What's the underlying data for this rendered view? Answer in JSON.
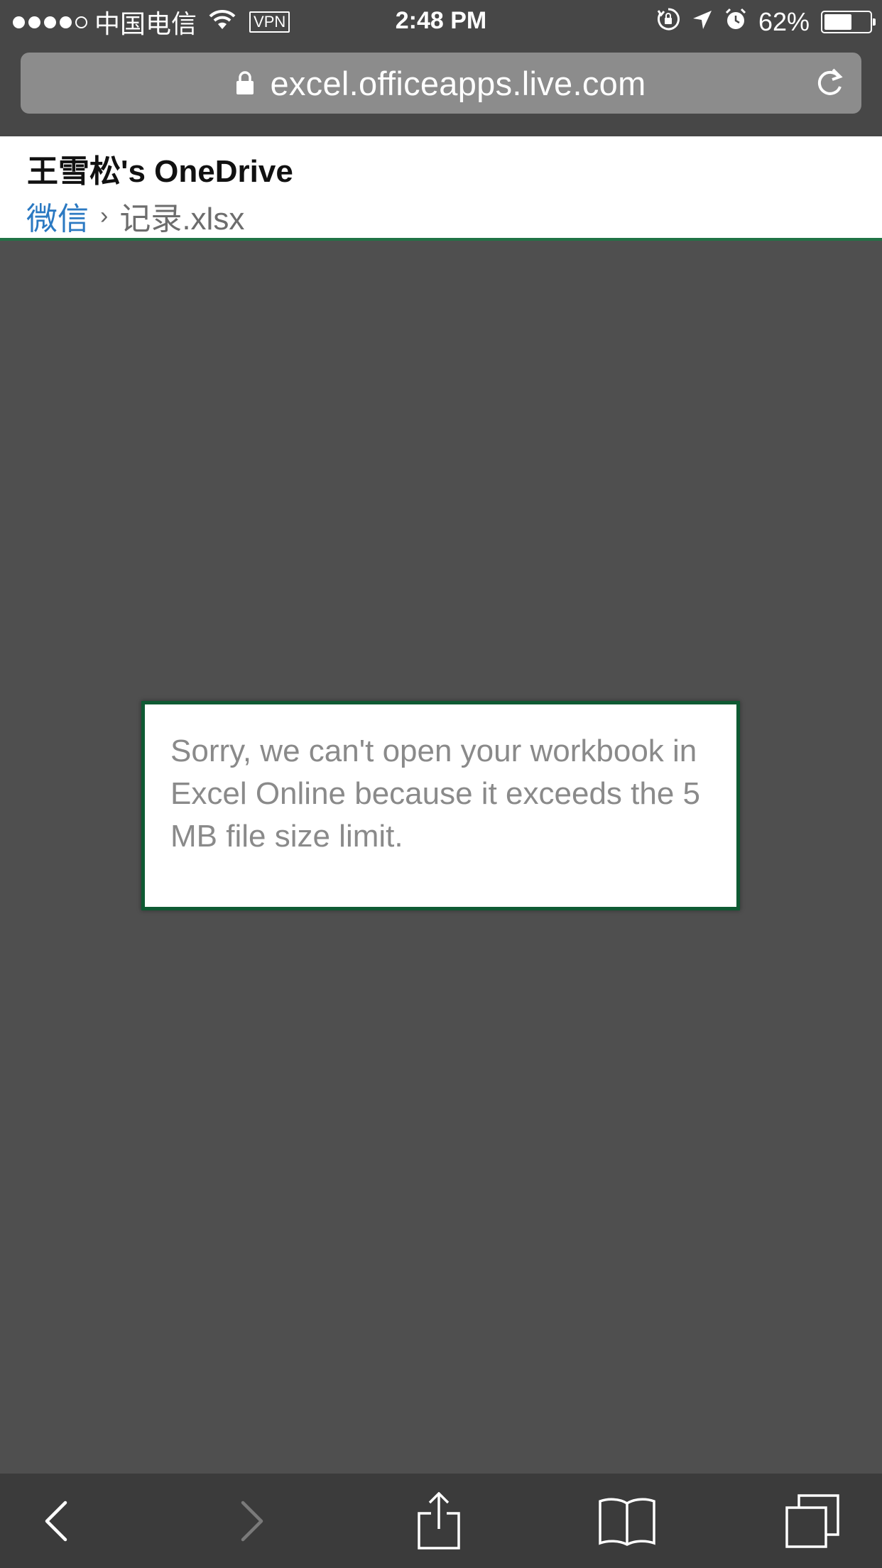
{
  "status_bar": {
    "carrier": "中国电信",
    "vpn": "VPN",
    "time": "2:48 PM",
    "battery_percent": "62%",
    "battery_level": 0.62,
    "icons": [
      "signal-dots-icon",
      "wifi-icon",
      "orientation-lock-icon",
      "location-arrow-icon",
      "alarm-icon",
      "battery-icon"
    ]
  },
  "address_bar": {
    "url": "excel.officeapps.live.com"
  },
  "header": {
    "title": "王雪松's OneDrive",
    "breadcrumb": {
      "folder": "微信",
      "separator": "›",
      "file": "记录.xlsx"
    }
  },
  "dialog": {
    "message": "Sorry, we can't open your workbook in Excel Online because it exceeds the 5 MB file size limit."
  },
  "toolbar": {
    "buttons": [
      "back-icon",
      "forward-icon",
      "share-icon",
      "bookmarks-icon",
      "tabs-icon"
    ]
  },
  "colors": {
    "excel_green": "#217346",
    "link_blue": "#2b79c2",
    "page_bg": "#4f4f4f",
    "chrome_bg": "#474747",
    "toolbar_bg": "#3b3b3b"
  }
}
